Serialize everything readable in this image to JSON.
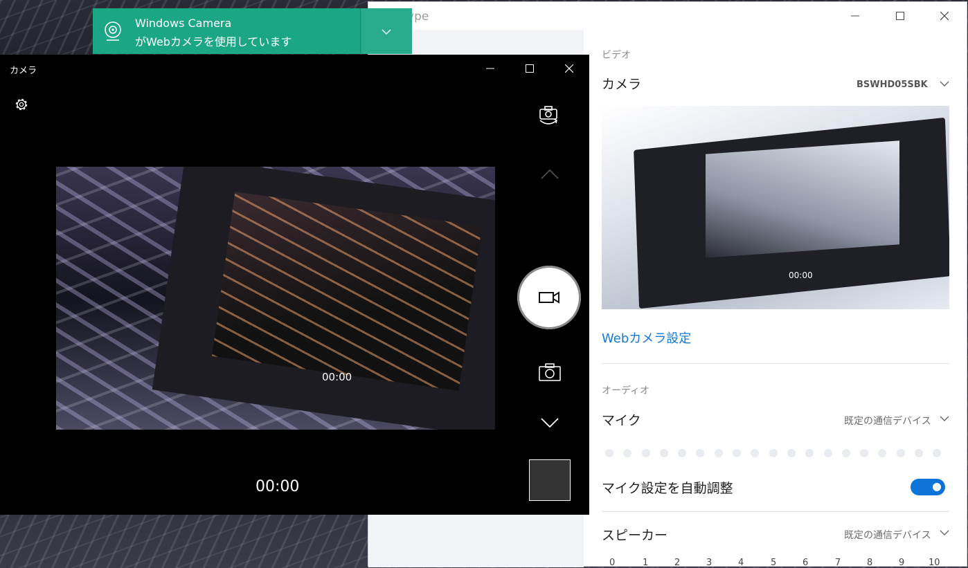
{
  "skype": {
    "app_title": "Skype",
    "video_section": "ビデオ",
    "camera_label": "カメラ",
    "camera_device": "BSWHD05SBK",
    "preview_timer": "00:00",
    "webcam_settings_link": "Webカメラ設定",
    "audio_section": "オーディオ",
    "mic_label": "マイク",
    "mic_device": "既定の通信デバイス",
    "auto_adjust_label": "マイク設定を自動調整",
    "auto_adjust_on": true,
    "speaker_label": "スピーカー",
    "speaker_device": "既定の通信デバイス",
    "volume_scale": [
      "0",
      "1",
      "2",
      "3",
      "4",
      "5",
      "6",
      "7",
      "8",
      "9",
      "10"
    ],
    "toggle_color": "#0e73d8",
    "link_color": "#1478d4"
  },
  "toast": {
    "app_name": "Windows Camera",
    "message": "がWebカメラを使用しています",
    "color": "#1ba786"
  },
  "camera": {
    "title": "カメラ",
    "viewfinder_timer": "00:00",
    "timer": "00:00",
    "mode": "video"
  }
}
